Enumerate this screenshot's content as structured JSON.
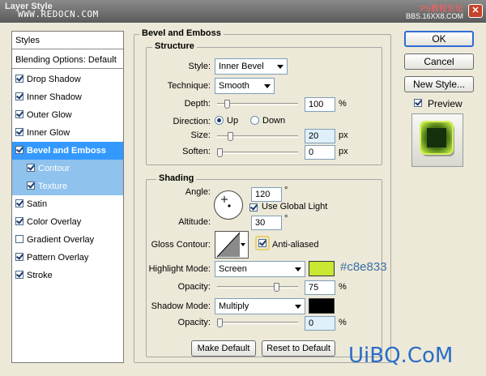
{
  "window": {
    "title": "Layer Style",
    "watermark_left": "WWW.REDOCN.COM",
    "watermark_right_top": "PS教程论坛",
    "watermark_right_bottom": "BBS.16XX8.COM",
    "close_glyph": "✕"
  },
  "styles_list": {
    "header": "Styles",
    "blending": "Blending Options: Default",
    "items": [
      {
        "label": "Drop Shadow",
        "checked": true
      },
      {
        "label": "Inner Shadow",
        "checked": true
      },
      {
        "label": "Outer Glow",
        "checked": true
      },
      {
        "label": "Inner Glow",
        "checked": true
      },
      {
        "label": "Bevel and Emboss",
        "checked": true,
        "selected": true
      },
      {
        "label": "Contour",
        "checked": true,
        "sub": true
      },
      {
        "label": "Texture",
        "checked": true,
        "sub": true
      },
      {
        "label": "Satin",
        "checked": true
      },
      {
        "label": "Color Overlay",
        "checked": true
      },
      {
        "label": "Gradient Overlay",
        "checked": false
      },
      {
        "label": "Pattern Overlay",
        "checked": true
      },
      {
        "label": "Stroke",
        "checked": true
      }
    ]
  },
  "bevel": {
    "section_title": "Bevel and Emboss",
    "structure": {
      "title": "Structure",
      "style_label": "Style:",
      "style_value": "Inner Bevel",
      "technique_label": "Technique:",
      "technique_value": "Smooth",
      "depth_label": "Depth:",
      "depth_value": "100",
      "depth_unit": "%",
      "depth_level": 0.1,
      "direction_label": "Direction:",
      "dir_up": "Up",
      "dir_down": "Down",
      "direction_selected": "Up",
      "size_label": "Size:",
      "size_value": "20",
      "size_unit": "px",
      "size_level": 0.14,
      "soften_label": "Soften:",
      "soften_value": "0",
      "soften_unit": "px",
      "soften_level": 0.0
    },
    "shading": {
      "title": "Shading",
      "angle_label": "Angle:",
      "angle_value": "120",
      "angle_unit": "°",
      "global_light_label": "Use Global Light",
      "global_light": true,
      "altitude_label": "Altitude:",
      "altitude_value": "30",
      "altitude_unit": "°",
      "gloss_label": "Gloss Contour:",
      "anti_aliased_label": "Anti-aliased",
      "anti_aliased": true,
      "highlight_label": "Highlight Mode:",
      "highlight_value": "Screen",
      "highlight_color": "#c8e833",
      "highlight_hex_label": "#c8e833",
      "opacity1_label": "Opacity:",
      "opacity1_value": "75",
      "opacity1_unit": "%",
      "opacity1_level": 0.75,
      "shadow_label": "Shadow Mode:",
      "shadow_value": "Multiply",
      "shadow_color": "#000000",
      "opacity2_label": "Opacity:",
      "opacity2_value": "0",
      "opacity2_unit": "%",
      "opacity2_level": 0.0
    },
    "make_default": "Make Default",
    "reset_default": "Reset to Default"
  },
  "buttons": {
    "ok": "OK",
    "cancel": "Cancel",
    "new_style": "New Style...",
    "preview_label": "Preview",
    "preview_checked": true
  },
  "footer_logo": "UiBQ.CoM"
}
